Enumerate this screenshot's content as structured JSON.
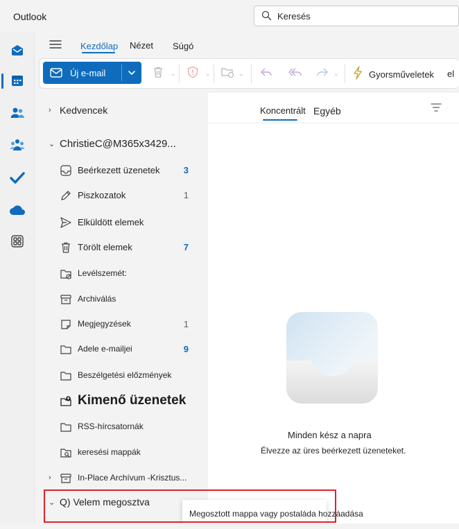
{
  "app": {
    "title": "Outlook"
  },
  "search": {
    "placeholder": "Keresés"
  },
  "ribbon": {
    "tabs": [
      {
        "label": "Kezdőlap",
        "active": true
      },
      {
        "label": "Nézet",
        "active": false
      },
      {
        "label": "Súgó",
        "active": false
      }
    ],
    "new_mail_label": "Új e-mail",
    "quick_steps_label": "Gyorsműveletek",
    "overflow_text": "el"
  },
  "folders": {
    "favorites_label": "Kedvencek",
    "account_label": "ChristieC@M365x3429...",
    "items": [
      {
        "name": "Beérkezett üzenetek",
        "count": "3",
        "count_style": "blue",
        "icon": "inbox-icon"
      },
      {
        "name": "Piszkozatok",
        "count": "1",
        "count_style": "gray",
        "icon": "pencil-icon"
      },
      {
        "name": "Elküldött elemek",
        "count": "",
        "count_style": "",
        "icon": "send-icon"
      },
      {
        "name": "Törölt elemek",
        "count": "7",
        "count_style": "blue",
        "icon": "trash-icon"
      },
      {
        "name": "Levélszemét:",
        "count": "",
        "count_style": "",
        "icon": "junk-folder-icon"
      },
      {
        "name": "Archiválás",
        "count": "",
        "count_style": "",
        "icon": "archive-icon"
      },
      {
        "name": "Megjegyzések",
        "count": "1",
        "count_style": "gray",
        "icon": "note-icon"
      },
      {
        "name": "Adele e-mailjei",
        "count": "9",
        "count_style": "blue",
        "icon": "folder-icon"
      },
      {
        "name": "Beszélgetési előzmények",
        "count": "",
        "count_style": "",
        "icon": "folder-icon"
      },
      {
        "name": "Kimenő üzenetek",
        "count": "",
        "count_style": "large",
        "icon": "outbox-icon"
      },
      {
        "name": "RSS-hírcsatornák",
        "count": "",
        "count_style": "",
        "icon": "folder-icon"
      },
      {
        "name": "keresési mappák",
        "count": "",
        "count_style": "",
        "icon": "search-folder-icon"
      }
    ],
    "archive_label": "In-Place Archívum -Krisztus...",
    "shared_label": "Q) Velem megosztva"
  },
  "messages": {
    "tab_focused": "Koncentrált",
    "tab_other": "Egyéb",
    "empty_title": "Minden kész a napra",
    "empty_subtitle": "Élvezze az üres beérkezett üzeneteket."
  },
  "callout": {
    "text": "Megosztott mappa vagy postaláda hozzáadása"
  },
  "colors": {
    "accent": "#0f6cbd",
    "highlight": "#e0202a"
  }
}
